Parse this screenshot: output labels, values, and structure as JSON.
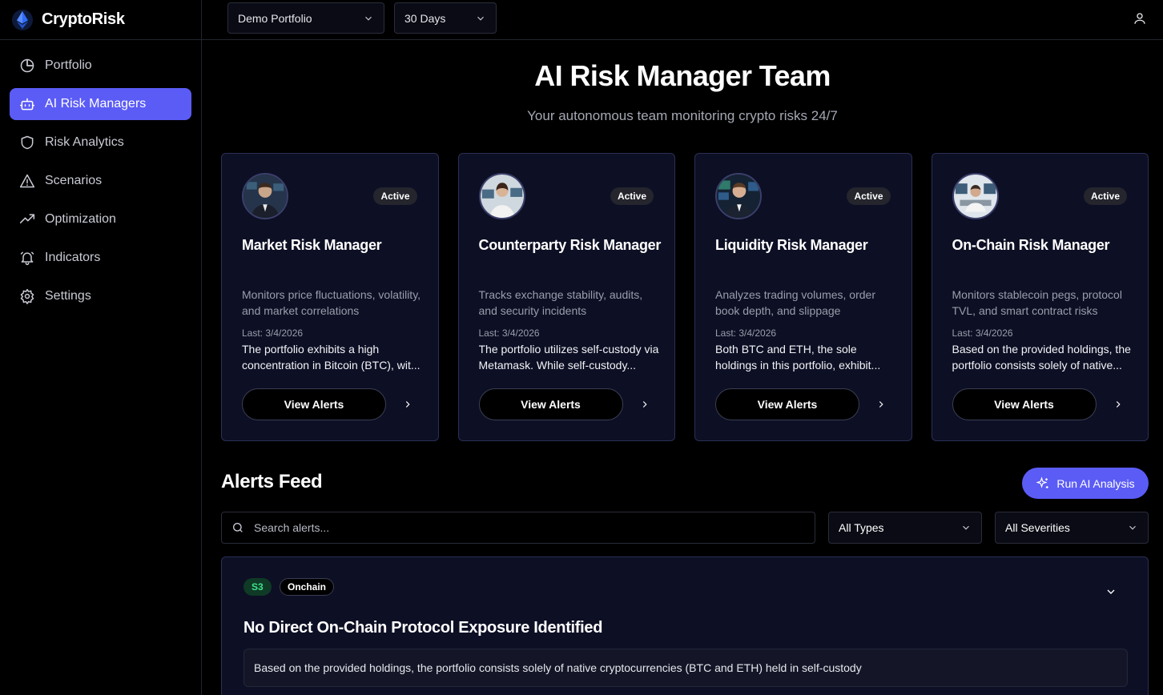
{
  "brand": {
    "name": "CryptoRisk"
  },
  "sidebar": {
    "items": [
      {
        "label": "Portfolio",
        "icon": "pie-chart-icon"
      },
      {
        "label": "AI Risk Managers",
        "icon": "bot-icon",
        "active": true
      },
      {
        "label": "Risk Analytics",
        "icon": "shield-icon"
      },
      {
        "label": "Scenarios",
        "icon": "alert-triangle-icon"
      },
      {
        "label": "Optimization",
        "icon": "trending-up-icon"
      },
      {
        "label": "Indicators",
        "icon": "bell-icon"
      },
      {
        "label": "Settings",
        "icon": "gear-icon"
      }
    ]
  },
  "topbar": {
    "portfolio_select": "Demo Portfolio",
    "period_select": "30 Days"
  },
  "page": {
    "title": "AI Risk Manager Team",
    "subtitle": "Your autonomous team monitoring crypto risks 24/7"
  },
  "managers": [
    {
      "status": "Active",
      "title": "Market Risk Manager",
      "description": "Monitors price fluctuations, volatility, and market correlations",
      "last": "Last: 3/4/2026",
      "summary": "The portfolio exhibits a high concentration in Bitcoin (BTC), wit...",
      "button": "View Alerts"
    },
    {
      "status": "Active",
      "title": "Counterparty Risk Manager",
      "description": "Tracks exchange stability, audits, and security incidents",
      "last": "Last: 3/4/2026",
      "summary": "The portfolio utilizes self-custody via Metamask. While self-custody...",
      "button": "View Alerts"
    },
    {
      "status": "Active",
      "title": "Liquidity Risk Manager",
      "description": "Analyzes trading volumes, order book depth, and slippage",
      "last": "Last: 3/4/2026",
      "summary": "Both BTC and ETH, the sole holdings in this portfolio, exhibit...",
      "button": "View Alerts"
    },
    {
      "status": "Active",
      "title": "On-Chain Risk Manager",
      "description": "Monitors stablecoin pegs, protocol TVL, and smart contract risks",
      "last": "Last: 3/4/2026",
      "summary": "Based on the provided holdings, the portfolio consists solely of native...",
      "button": "View Alerts"
    }
  ],
  "feed": {
    "title": "Alerts Feed",
    "run_button": "Run AI Analysis",
    "search_placeholder": "Search alerts...",
    "type_filter": "All Types",
    "severity_filter": "All Severities",
    "alert": {
      "severity": "S3",
      "type": "Onchain",
      "title": "No Direct On-Chain Protocol Exposure Identified",
      "body": "Based on the provided holdings, the portfolio consists solely of native cryptocurrencies (BTC and ETH) held in self-custody"
    }
  },
  "colors": {
    "accent": "#5b5cf6",
    "card_bg": "#0d0f24",
    "severity_s3": "#3ee08a"
  }
}
